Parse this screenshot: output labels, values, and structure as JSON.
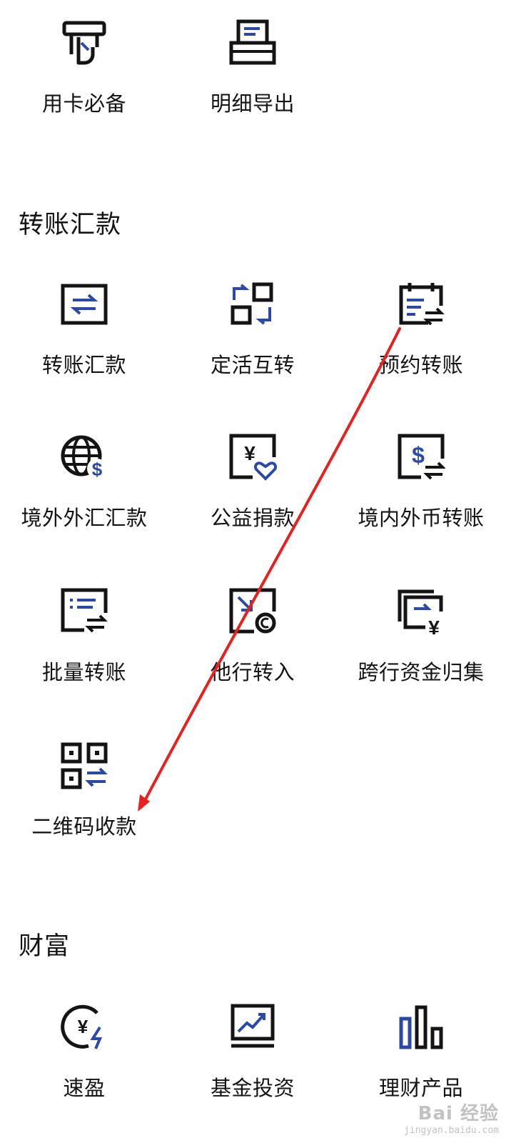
{
  "colors": {
    "icon_dark": "#141414",
    "icon_accent": "#2c49a6",
    "annotation_arrow": "#e8201f"
  },
  "top_items": [
    {
      "label": "用卡必备",
      "icon": "card-hand-icon"
    },
    {
      "label": "明细导出",
      "icon": "printer-icon"
    }
  ],
  "transfer": {
    "title": "转账汇款",
    "items": [
      {
        "label": "转账汇款",
        "icon": "transfer-arrows-icon"
      },
      {
        "label": "定活互转",
        "icon": "fixed-current-swap-icon"
      },
      {
        "label": "预约转账",
        "icon": "calendar-transfer-icon"
      },
      {
        "label": "境外外汇汇款",
        "icon": "globe-dollar-icon"
      },
      {
        "label": "公益捐款",
        "icon": "yen-heart-icon"
      },
      {
        "label": "境内外币转账",
        "icon": "dollar-transfer-icon"
      },
      {
        "label": "批量转账",
        "icon": "list-transfer-icon"
      },
      {
        "label": "他行转入",
        "icon": "inbound-bank-icon"
      },
      {
        "label": "跨行资金归集",
        "icon": "stacked-yen-icon"
      },
      {
        "label": "二维码收款",
        "icon": "qr-code-icon"
      }
    ]
  },
  "wealth": {
    "title": "财富",
    "items": [
      {
        "label": "速盈",
        "icon": "yen-lightning-icon"
      },
      {
        "label": "基金投资",
        "icon": "chart-monitor-icon"
      },
      {
        "label": "理财产品",
        "icon": "bar-chart-icon"
      }
    ]
  },
  "watermark": {
    "text": "Bai 经验",
    "sub": "jingyan.baidu.com"
  }
}
